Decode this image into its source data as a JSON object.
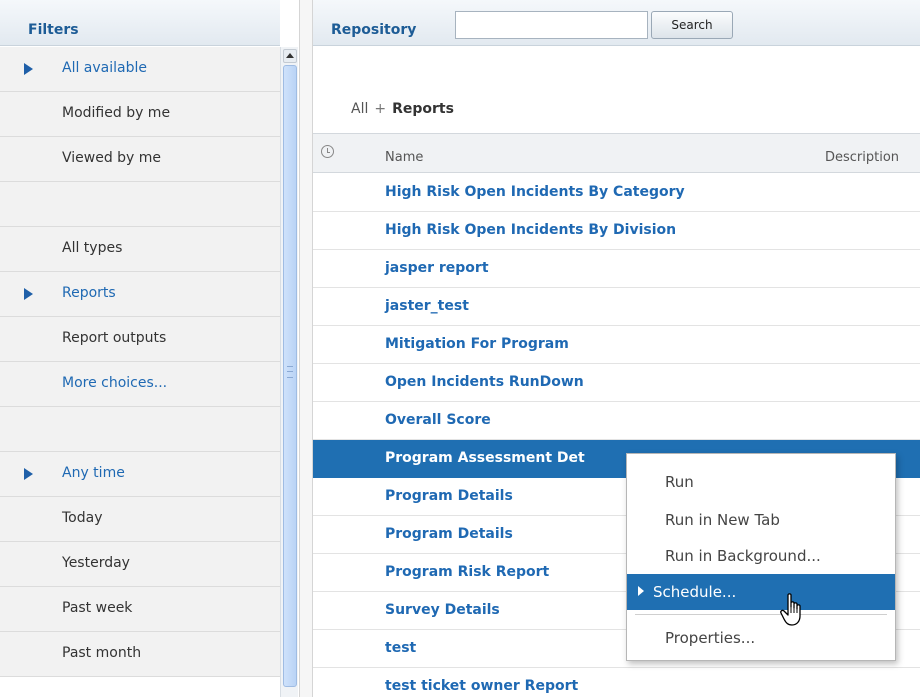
{
  "filters": {
    "title": "Filters",
    "items": [
      {
        "label": "All available",
        "selected": true
      },
      {
        "label": "Modified by me"
      },
      {
        "label": "Viewed by me"
      },
      {
        "label": ""
      },
      {
        "label": "All types"
      },
      {
        "label": "Reports",
        "selected": true
      },
      {
        "label": "Report outputs"
      },
      {
        "label": "More choices...",
        "link": true
      },
      {
        "label": ""
      },
      {
        "label": "Any time",
        "selected": true
      },
      {
        "label": "Today"
      },
      {
        "label": "Yesterday"
      },
      {
        "label": "Past week"
      },
      {
        "label": "Past month"
      }
    ]
  },
  "repository": {
    "title": "Repository",
    "search": {
      "value": "",
      "button": "Search"
    },
    "breadcrumb": {
      "root": "All",
      "separator": "+",
      "current": "Reports"
    },
    "columns": {
      "name": "Name",
      "description": "Description"
    },
    "rows": [
      "High Risk Open Incidents By Category",
      "High Risk Open Incidents By Division",
      "jasper report",
      "jaster_test",
      "Mitigation For Program",
      "Open Incidents RunDown",
      "Overall Score",
      "Program Assessment Det",
      "Program Details",
      "Program Details",
      "Program Risk Report",
      "Survey Details",
      "test",
      "test ticket owner Report"
    ],
    "selected_row": "Program Assessment Det"
  },
  "context_menu": {
    "items": [
      "Run",
      "Run in New Tab",
      "Run in Background...",
      "Schedule...",
      "Properties..."
    ],
    "highlighted": "Schedule..."
  },
  "colors": {
    "accent": "#1f6fb2",
    "link": "#1f69b3",
    "header_text": "#1d5c96"
  }
}
